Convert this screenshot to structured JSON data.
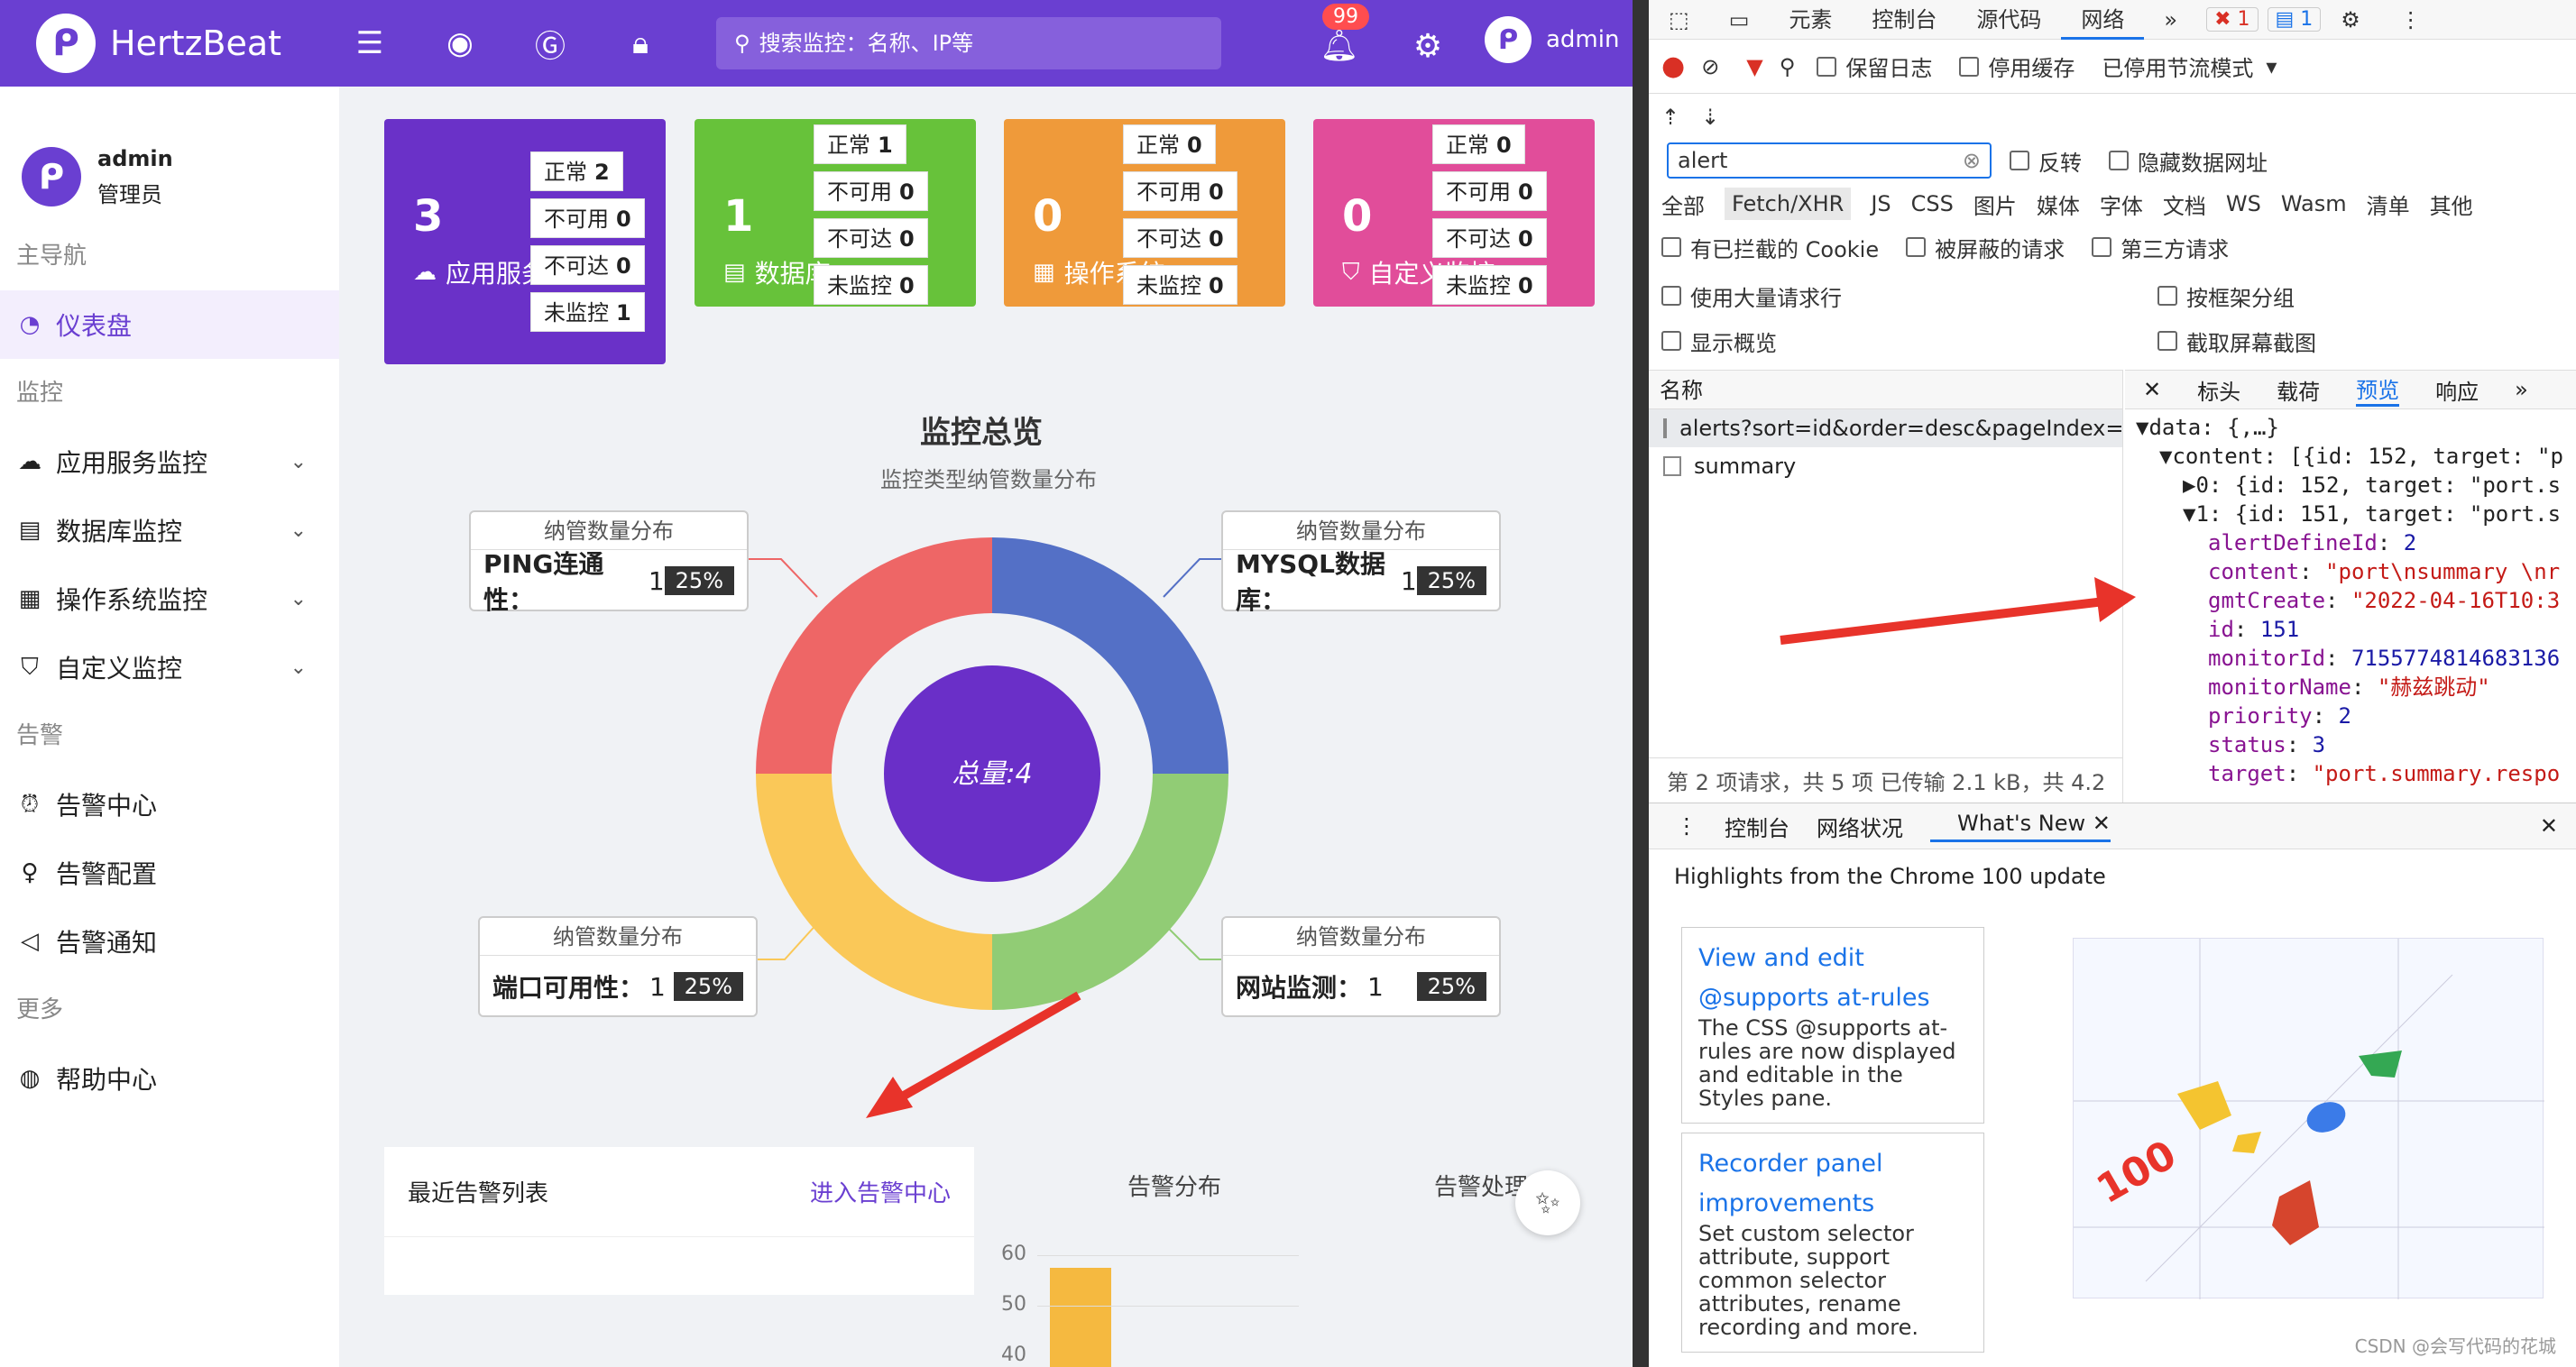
{
  "header": {
    "app_name": "HertzBeat",
    "search_placeholder": "搜索监控：名称、IP等",
    "notif_count": "99",
    "user": "admin"
  },
  "sidebar": {
    "user_name": "admin",
    "user_role": "管理员",
    "groups": [
      {
        "title": "主导航",
        "items": [
          {
            "label": "仪表盘",
            "icon": "dashboard-icon",
            "active": true
          }
        ]
      },
      {
        "title": "监控",
        "items": [
          {
            "label": "应用服务监控",
            "icon": "cloud-icon"
          },
          {
            "label": "数据库监控",
            "icon": "database-icon"
          },
          {
            "label": "操作系统监控",
            "icon": "os-icon"
          },
          {
            "label": "自定义监控",
            "icon": "shirt-icon"
          }
        ]
      },
      {
        "title": "告警",
        "items": [
          {
            "label": "告警中心",
            "icon": "alarm-icon"
          },
          {
            "label": "告警配置",
            "icon": "bulb-icon"
          },
          {
            "label": "告警通知",
            "icon": "megaphone-icon"
          }
        ]
      },
      {
        "title": "更多",
        "items": [
          {
            "label": "帮助中心",
            "icon": "globe-icon"
          }
        ]
      }
    ]
  },
  "cards": [
    {
      "count": "3",
      "label": "应用服务",
      "icon": "cloud-icon",
      "color": "#6a31c8",
      "stats": [
        {
          "k": "正常",
          "v": "2"
        },
        {
          "k": "不可用",
          "v": "0"
        },
        {
          "k": "不可达",
          "v": "0"
        },
        {
          "k": "未监控",
          "v": "1"
        }
      ]
    },
    {
      "count": "1",
      "label": "数据库",
      "icon": "database-icon",
      "color": "#67c23a",
      "stats": [
        {
          "k": "正常",
          "v": "1"
        },
        {
          "k": "不可用",
          "v": "0"
        },
        {
          "k": "不可达",
          "v": "0"
        },
        {
          "k": "未监控",
          "v": "0"
        }
      ]
    },
    {
      "count": "0",
      "label": "操作系统",
      "icon": "os-icon",
      "color": "#ef9a3a",
      "stats": [
        {
          "k": "正常",
          "v": "0"
        },
        {
          "k": "不可用",
          "v": "0"
        },
        {
          "k": "不可达",
          "v": "0"
        },
        {
          "k": "未监控",
          "v": "0"
        }
      ]
    },
    {
      "count": "0",
      "label": "自定义监控",
      "icon": "shirt-icon",
      "color": "#e14d9a",
      "stats": [
        {
          "k": "正常",
          "v": "0"
        },
        {
          "k": "不可用",
          "v": "0"
        },
        {
          "k": "不可达",
          "v": "0"
        },
        {
          "k": "未监控",
          "v": "0"
        }
      ]
    }
  ],
  "overview": {
    "title": "监控总览",
    "subtitle": "监控类型纳管数量分布",
    "total_label": "总量:4"
  },
  "chart_data": {
    "type": "pie",
    "title": "监控总览",
    "subtitle": "监控类型纳管数量分布",
    "slices": [
      {
        "name": "MYSQL数据库",
        "value": 1,
        "percent": "25%",
        "color": "#5470c6"
      },
      {
        "name": "网站监测",
        "value": 1,
        "percent": "25%",
        "color": "#91cc75"
      },
      {
        "name": "端口可用性",
        "value": 1,
        "percent": "25%",
        "color": "#fac858"
      },
      {
        "name": "PING连通性",
        "value": 1,
        "percent": "25%",
        "color": "#ee6666"
      }
    ],
    "total": 4
  },
  "tooltips": [
    {
      "title": "纳管数量分布",
      "name": "PING连通性：",
      "value": "1",
      "pct": "25%"
    },
    {
      "title": "纳管数量分布",
      "name": "MYSQL数据库：",
      "value": "1",
      "pct": "25%"
    },
    {
      "title": "纳管数量分布",
      "name": "端口可用性：",
      "value": "1",
      "pct": "25%"
    },
    {
      "title": "纳管数量分布",
      "name": "网站监测：",
      "value": "1",
      "pct": "25%"
    }
  ],
  "alerts": {
    "title": "最近告警列表",
    "link": "进入告警中心",
    "dist_label": "告警分布",
    "handle_label": "告警处理",
    "ticks": [
      "60",
      "50",
      "40"
    ]
  },
  "devtools": {
    "tabs": [
      "元素",
      "控制台",
      "源代码",
      "网络"
    ],
    "errors": "1",
    "messages": "1",
    "toolbar_checks": [
      "保留日志",
      "停用缓存"
    ],
    "throttle": "已停用节流模式",
    "filter_value": "alert",
    "filter_checks": [
      "反转",
      "隐藏数据网址"
    ],
    "types": [
      "全部",
      "Fetch/XHR",
      "JS",
      "CSS",
      "图片",
      "媒体",
      "字体",
      "文档",
      "WS",
      "Wasm",
      "清单",
      "其他"
    ],
    "extra_checks": [
      "有已拦截的 Cookie",
      "被屏蔽的请求",
      "第三方请求"
    ],
    "opt_left": [
      "使用大量请求行",
      "显示概览"
    ],
    "opt_right": [
      "按框架分组",
      "截取屏幕截图"
    ],
    "name_header": "名称",
    "requests": [
      "alerts?sort=id&order=desc&pageIndex=...",
      "summary"
    ],
    "footer": "第 2 项请求，共 5 项   已传输 2.1 kB，共 4.2",
    "preview_tabs": [
      "标头",
      "载荷",
      "预览",
      "响应"
    ],
    "preview_lines": [
      {
        "t": "▼data: {,…}",
        "ind": 0
      },
      {
        "t": "▼content: [{id: 152, target: \"p",
        "ind": 1
      },
      {
        "t": "▶0: {id: 152, target: \"port.s",
        "ind": 2
      },
      {
        "t": "▼1: {id: 151, target: \"port.s",
        "ind": 2
      }
    ],
    "props": [
      {
        "k": "alertDefineId",
        "v": "2",
        "c": "n"
      },
      {
        "k": "content",
        "v": "\"port\\nsummary \\nr",
        "c": "s"
      },
      {
        "k": "gmtCreate",
        "v": "\"2022-04-16T10:3",
        "c": "s"
      },
      {
        "k": "id",
        "v": "151",
        "c": "n"
      },
      {
        "k": "monitorId",
        "v": "7155774814683136",
        "c": "n"
      },
      {
        "k": "monitorName",
        "v": "\"赫兹跳动\"",
        "c": "s"
      },
      {
        "k": "priority",
        "v": "2",
        "c": "n"
      },
      {
        "k": "status",
        "v": "3",
        "c": "n"
      },
      {
        "k": "target",
        "v": "\"port.summary.respo",
        "c": "s"
      }
    ],
    "drawer_tabs": [
      "控制台",
      "网络状况",
      "What's New"
    ],
    "whatsnew_head": "Highlights from the Chrome 100 update",
    "cards": [
      {
        "a1": "View and edit",
        "a2": "@supports at-rules",
        "p": "The CSS @supports at-rules are now displayed and editable in the Styles pane."
      },
      {
        "a1": "Recorder panel",
        "a2": "improvements",
        "p": "Set custom selector attribute, support common selector attributes, rename recording and more."
      }
    ],
    "img_text": "100",
    "watermark": "CSDN @会写代码的花城"
  }
}
